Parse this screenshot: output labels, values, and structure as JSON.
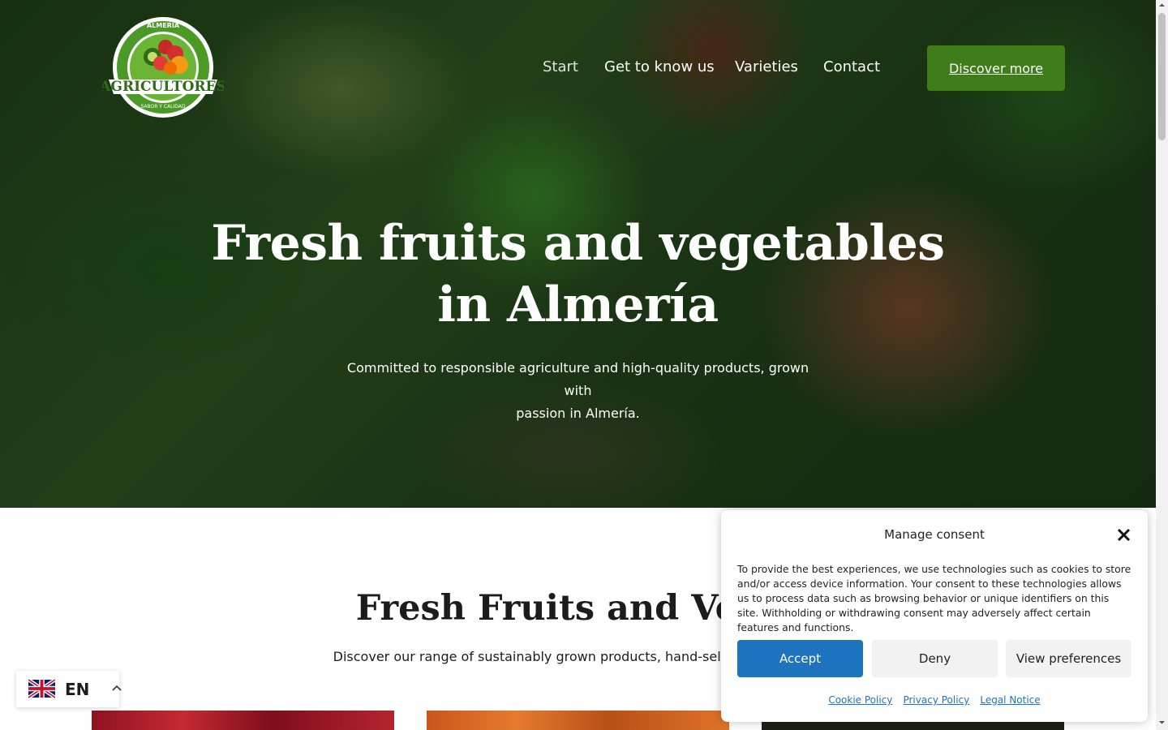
{
  "header": {
    "logo": {
      "arc_top": "ALMERÍA",
      "banner": "AGRICULTORES",
      "arc_bottom": "SABOR Y CALIDAD"
    },
    "nav": [
      {
        "label": "Start",
        "active": true
      },
      {
        "label": "Get to know us",
        "active": false
      },
      {
        "label": "Varieties",
        "active": false
      },
      {
        "label": "Contact",
        "active": false
      }
    ],
    "cta_label": "Discover more"
  },
  "hero": {
    "title_line1": "Fresh fruits and vegetables",
    "title_line2": "in Almería",
    "subtitle_line1": "Committed to responsible agriculture and high-quality products, grown with",
    "subtitle_line2": "passion in Almería."
  },
  "products": {
    "title": "Fresh Fruits and Veget",
    "subtitle": "Discover our range of sustainably grown products, hand-selected to ensure"
  },
  "language": {
    "code": "EN",
    "flag": "uk-flag-icon"
  },
  "consent": {
    "title": "Manage consent",
    "text": "To provide the best experiences, we use technologies such as cookies to store and/or access device information. Your consent to these technologies allows us to process data such as browsing behavior or unique identifiers on this site. Withholding or withdrawing consent may adversely affect certain features and functions.",
    "accept": "Accept",
    "deny": "Deny",
    "preferences": "View preferences",
    "links": [
      "Cookie Policy",
      "Privacy Policy",
      "Legal Notice"
    ]
  },
  "colors": {
    "brand_green": "#3e7d17",
    "accept_blue": "#1e73be",
    "link_blue": "#1e73be"
  }
}
